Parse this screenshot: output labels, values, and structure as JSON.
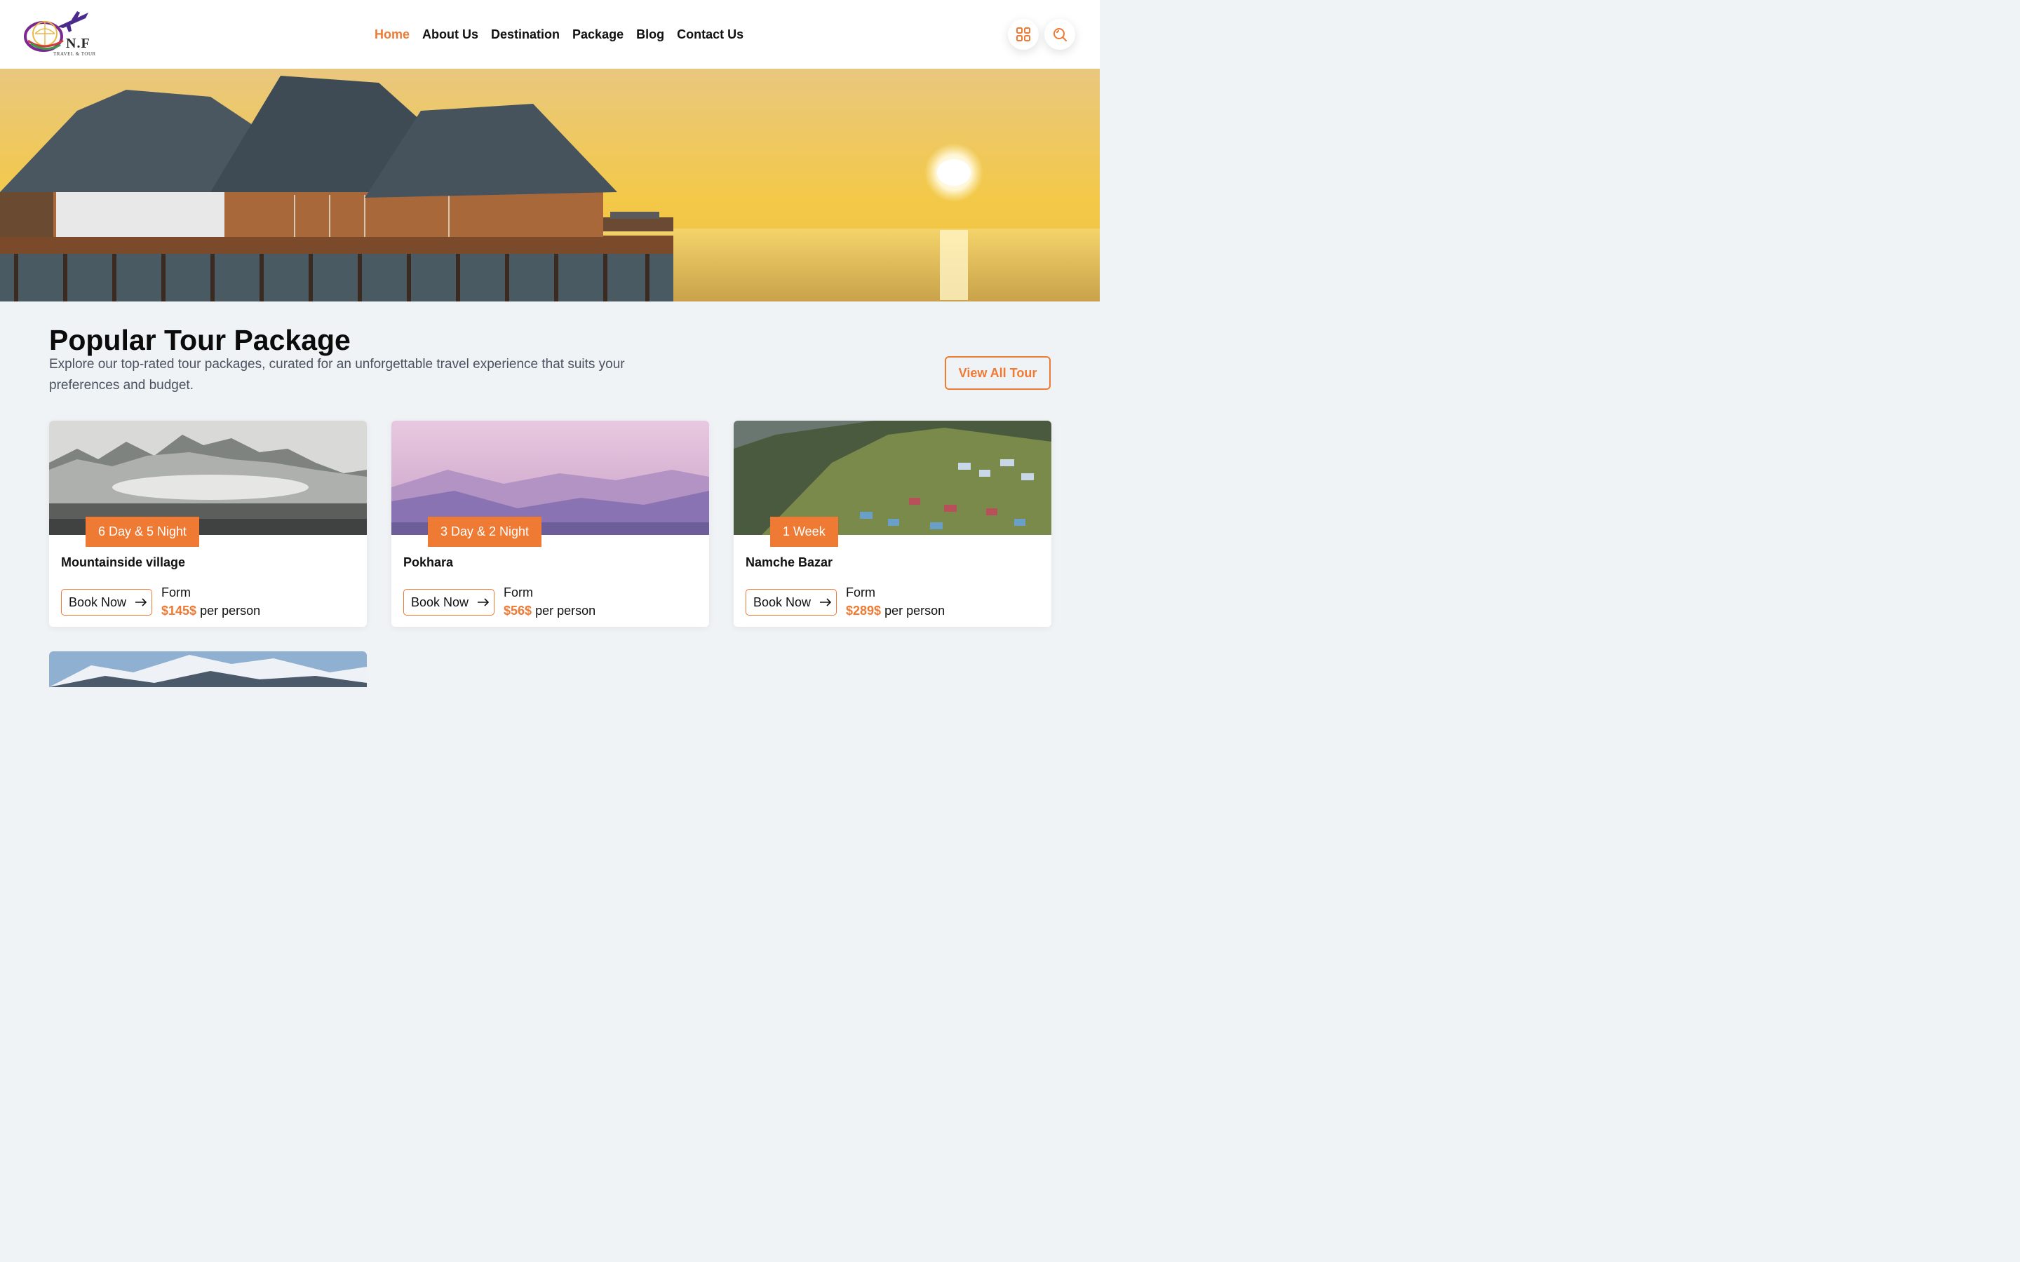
{
  "brand": {
    "name": "N.F",
    "tagline": "TRAVEL & TOUR"
  },
  "nav": {
    "items": [
      {
        "label": "Home",
        "active": true
      },
      {
        "label": "About Us"
      },
      {
        "label": "Destination"
      },
      {
        "label": "Package"
      },
      {
        "label": "Blog"
      },
      {
        "label": "Contact Us"
      }
    ]
  },
  "header_icons": [
    "grid-icon",
    "search-icon"
  ],
  "section": {
    "title": "Popular Tour Package",
    "description": "Explore our top-rated tour packages, curated for an unforgettable travel experience that suits your preferences and budget.",
    "view_all_label": "View All Tour"
  },
  "packages": [
    {
      "duration": "6 Day & 5 Night",
      "name": "Mountainside village",
      "book_label": "Book Now",
      "from_label": "Form",
      "price": "$145$",
      "per": "per person"
    },
    {
      "duration": "3 Day & 2 Night",
      "name": "Pokhara",
      "book_label": "Book Now",
      "from_label": "Form",
      "price": "$56$",
      "per": "per person"
    },
    {
      "duration": "1 Week",
      "name": "Namche Bazar",
      "book_label": "Book Now",
      "from_label": "Form",
      "price": "$289$",
      "per": "per person"
    }
  ],
  "colors": {
    "accent": "#ee7a33",
    "page_bg": "#f0f3f6",
    "text": "#111111",
    "muted": "#4a5260"
  }
}
